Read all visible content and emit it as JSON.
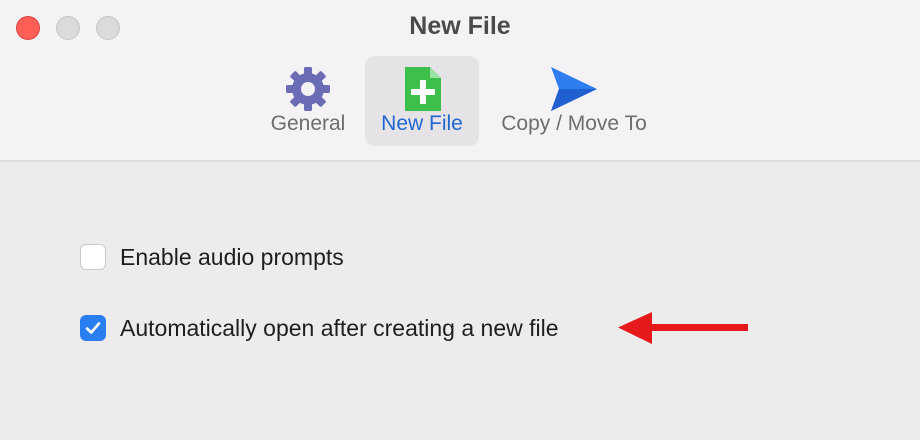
{
  "window": {
    "title": "New File",
    "controls": [
      "close-icon",
      "minimize-icon",
      "maximize-icon"
    ]
  },
  "toolbar": {
    "tabs": [
      {
        "label": "General",
        "icon": "gear-icon",
        "selected": false
      },
      {
        "label": "New File",
        "icon": "new-file-icon",
        "selected": true
      },
      {
        "label": "Copy / Move To",
        "icon": "send-icon",
        "selected": false
      }
    ]
  },
  "options": [
    {
      "label": "Enable audio prompts",
      "checked": false
    },
    {
      "label": "Automatically open after creating a new file",
      "checked": true
    }
  ],
  "annotation": {
    "icon": "red-arrow-icon",
    "color": "#e8191c"
  },
  "colors": {
    "accent": "#2a7ff0",
    "selected_tab_text": "#1f66d1",
    "close": "#ff5f57"
  }
}
